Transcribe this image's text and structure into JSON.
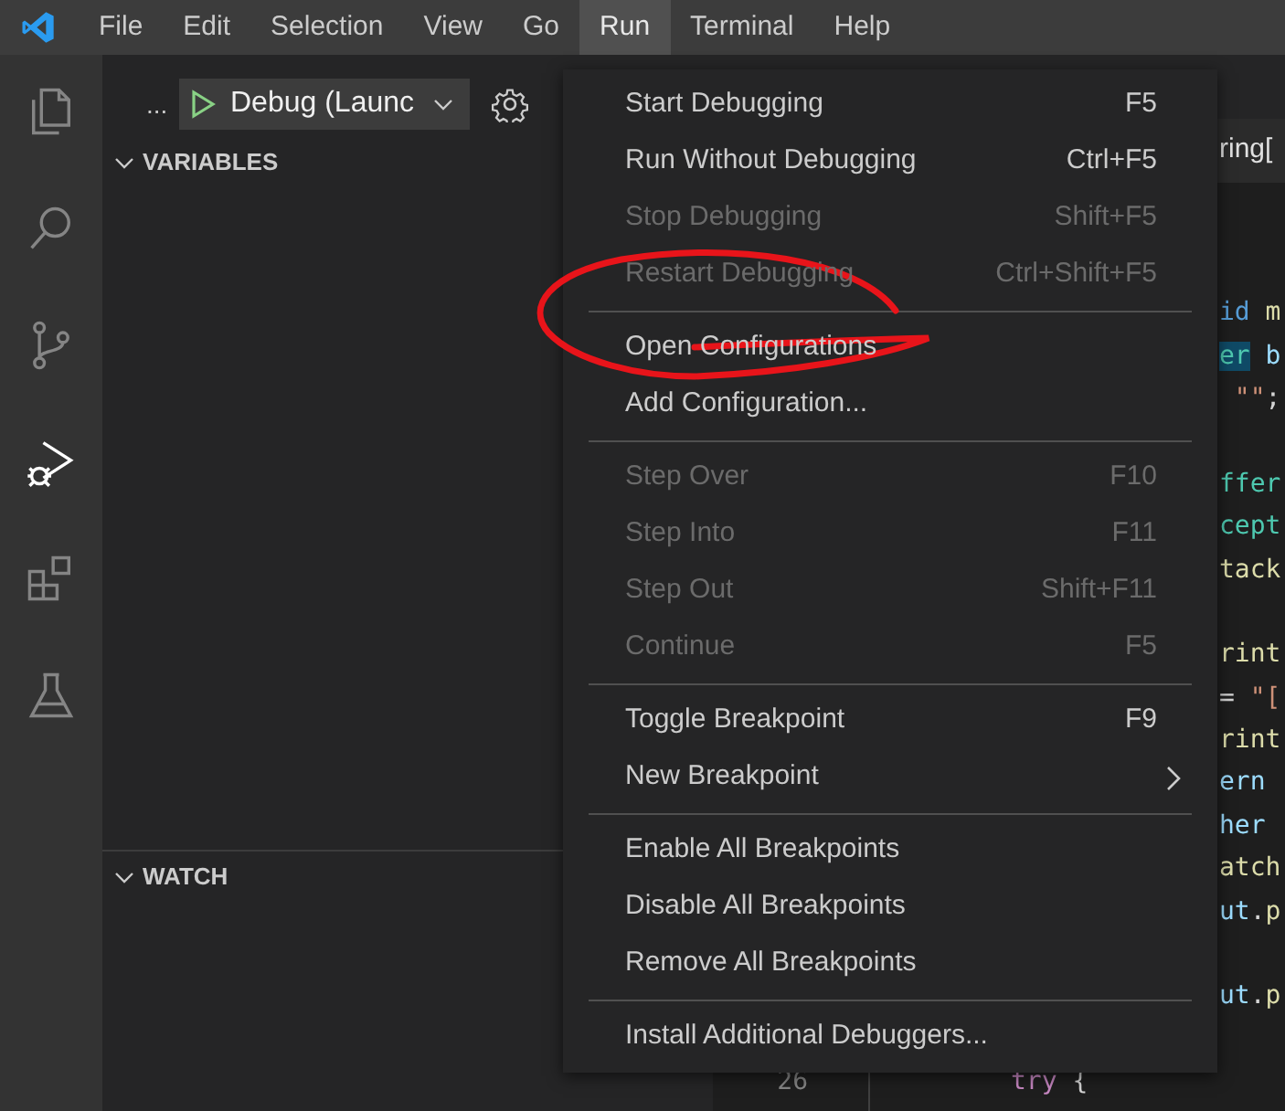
{
  "menu_bar": [
    {
      "label": "File",
      "selected": false
    },
    {
      "label": "Edit",
      "selected": false
    },
    {
      "label": "Selection",
      "selected": false
    },
    {
      "label": "View",
      "selected": false
    },
    {
      "label": "Go",
      "selected": false
    },
    {
      "label": "Run",
      "selected": true
    },
    {
      "label": "Terminal",
      "selected": false
    },
    {
      "label": "Help",
      "selected": false
    }
  ],
  "activity_bar": [
    {
      "kind": "files",
      "selected": false
    },
    {
      "kind": "search",
      "selected": false
    },
    {
      "kind": "source-control",
      "selected": false
    },
    {
      "kind": "run",
      "selected": true
    },
    {
      "kind": "extensions",
      "selected": false
    },
    {
      "kind": "testing",
      "selected": false
    }
  ],
  "sidebar": {
    "more": "...",
    "configuration": "Debug (Launc",
    "sections": [
      {
        "title": "VARIABLES",
        "expanded": true
      },
      {
        "title": "WATCH",
        "expanded": true
      }
    ]
  },
  "editor": {
    "breadcrumb": "ring[",
    "lines": [
      {
        "kind": "clipped",
        "tokens": [
          {
            "text": "id",
            "kind": "keyword"
          },
          {
            "text": " m",
            "kind": "function"
          }
        ]
      },
      {
        "kind": "clipped",
        "tokens": [
          {
            "text": "er",
            "kind": "type",
            "highlighted": true
          },
          {
            "text": " b",
            "kind": "variable"
          }
        ]
      },
      {
        "kind": "clipped",
        "tokens": [
          {
            "text": " \"\"",
            "kind": "string"
          },
          {
            "text": ";",
            "kind": "plain"
          }
        ]
      },
      {
        "kind": "blank"
      },
      {
        "kind": "clipped",
        "tokens": [
          {
            "text": "ffer",
            "kind": "type"
          }
        ]
      },
      {
        "kind": "clipped",
        "tokens": [
          {
            "text": "cept",
            "kind": "type"
          }
        ]
      },
      {
        "kind": "clipped",
        "tokens": [
          {
            "text": "tack",
            "kind": "function"
          }
        ]
      },
      {
        "kind": "blank"
      },
      {
        "kind": "clipped",
        "tokens": [
          {
            "text": "rint",
            "kind": "function"
          }
        ]
      },
      {
        "kind": "clipped",
        "tokens": [
          {
            "text": "= ",
            "kind": "plain"
          },
          {
            "text": "\"[",
            "kind": "string"
          }
        ]
      },
      {
        "kind": "clipped",
        "tokens": [
          {
            "text": "rint",
            "kind": "function"
          }
        ]
      },
      {
        "kind": "clipped",
        "tokens": [
          {
            "text": "ern",
            "kind": "variable"
          }
        ]
      },
      {
        "kind": "clipped",
        "tokens": [
          {
            "text": "her",
            "kind": "variable"
          }
        ]
      },
      {
        "kind": "clipped",
        "tokens": [
          {
            "text": "atch",
            "kind": "function"
          }
        ]
      },
      {
        "kind": "clipped",
        "tokens": [
          {
            "text": "ut",
            "kind": "variable"
          },
          {
            "text": ".",
            "kind": "plain"
          },
          {
            "text": "p",
            "kind": "function"
          }
        ]
      },
      {
        "kind": "blank"
      },
      {
        "kind": "clipped",
        "tokens": [
          {
            "text": "ut",
            "kind": "variable"
          },
          {
            "text": ".",
            "kind": "plain"
          },
          {
            "text": "p",
            "kind": "function"
          }
        ]
      },
      {
        "kind": "blank"
      },
      {
        "kind": "full",
        "number": "26",
        "tokens": [
          {
            "text": "try",
            "kind": "control"
          },
          {
            "text": " {",
            "kind": "plain"
          }
        ]
      }
    ]
  },
  "run_menu": [
    [
      {
        "label": "Start Debugging",
        "shortcut": "F5",
        "disabled": false
      },
      {
        "label": "Run Without Debugging",
        "shortcut": "Ctrl+F5",
        "disabled": false
      },
      {
        "label": "Stop Debugging",
        "shortcut": "Shift+F5",
        "disabled": true
      },
      {
        "label": "Restart Debugging",
        "shortcut": "Ctrl+Shift+F5",
        "disabled": true
      }
    ],
    [
      {
        "label": "Open Configurations",
        "disabled": false
      },
      {
        "label": "Add Configuration...",
        "disabled": false
      }
    ],
    [
      {
        "label": "Step Over",
        "shortcut": "F10",
        "disabled": true
      },
      {
        "label": "Step Into",
        "shortcut": "F11",
        "disabled": true
      },
      {
        "label": "Step Out",
        "shortcut": "Shift+F11",
        "disabled": true
      },
      {
        "label": "Continue",
        "shortcut": "F5",
        "disabled": true
      }
    ],
    [
      {
        "label": "Toggle Breakpoint",
        "shortcut": "F9",
        "disabled": false
      },
      {
        "label": "New Breakpoint",
        "submenu": true,
        "disabled": false
      }
    ],
    [
      {
        "label": "Enable All Breakpoints",
        "disabled": false
      },
      {
        "label": "Disable All Breakpoints",
        "disabled": false
      },
      {
        "label": "Remove All Breakpoints",
        "disabled": false
      }
    ],
    [
      {
        "label": "Install Additional Debuggers...",
        "disabled": false
      }
    ]
  ],
  "annotation": {
    "kind": "freehand-circle"
  }
}
